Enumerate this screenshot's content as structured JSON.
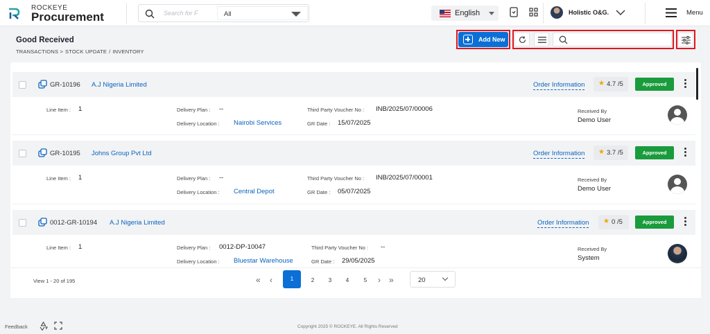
{
  "app": {
    "brand_top": "ROCKEYE",
    "brand_main": "Procurement"
  },
  "topbar": {
    "search_placeholder": "Search for F",
    "scope": "All",
    "language": "English",
    "user": "Holistic O&G.",
    "menu_label": "Menu",
    "icons": [
      "search-icon",
      "bookmark-icon",
      "apps-grid-icon",
      "chevron-down-icon",
      "hamburger-icon"
    ]
  },
  "page": {
    "title": "Good Received",
    "breadcrumb": [
      "TRANSACTIONS >",
      "STOCK UPDATE",
      "/",
      "INVENTORY"
    ],
    "add_new": "Add New"
  },
  "labels": {
    "line_item": "Line Item :",
    "delivery_plan": "Delivery Plan :",
    "delivery_location": "Delivery Location :",
    "third_party": "Third Party Voucher No :",
    "gr_date": "GR Date :",
    "received_by": "Received By",
    "order_info": "Order Information",
    "rating_suffix": "/5"
  },
  "records": [
    {
      "gr_no": "GR-10196",
      "vendor": "A.J Nigeria Limited",
      "rating": "4.7",
      "status": "Approved",
      "line_item": "1",
      "delivery_plan": "--",
      "delivery_location": "Nairobi Services",
      "voucher": "INB/2025/07/00006",
      "gr_date": "15/07/2025",
      "received_by": "Demo User"
    },
    {
      "gr_no": "GR-10195",
      "vendor": "Johns Group Pvt Ltd",
      "rating": "3.7",
      "status": "Approved",
      "line_item": "1",
      "delivery_plan": "--",
      "delivery_location": "Central Depot",
      "voucher": "INB/2025/07/00001",
      "gr_date": "05/07/2025",
      "received_by": "Demo User"
    },
    {
      "gr_no": "0012-GR-10194",
      "vendor": "A.J Nigeria Limited",
      "rating": "0",
      "status": "Approved",
      "line_item": "1",
      "delivery_plan": "0012-DP-10047",
      "delivery_location": "Bluestar Warehouse",
      "voucher": "--",
      "gr_date": "29/05/2025",
      "received_by": "System"
    }
  ],
  "pagination": {
    "view": "View 1 - 20 of 195",
    "pages": [
      "1",
      "2",
      "3",
      "4",
      "5"
    ],
    "page_size": "20"
  },
  "footer": {
    "feedback": "Feedback",
    "copyright": "Copyright 2025 © ROCKEYE. All Rights Reserved"
  },
  "colors": {
    "primary": "#0b6fd6",
    "approved": "#1a9b3c",
    "highlight": "#e0151d",
    "link": "#0b63bd"
  }
}
